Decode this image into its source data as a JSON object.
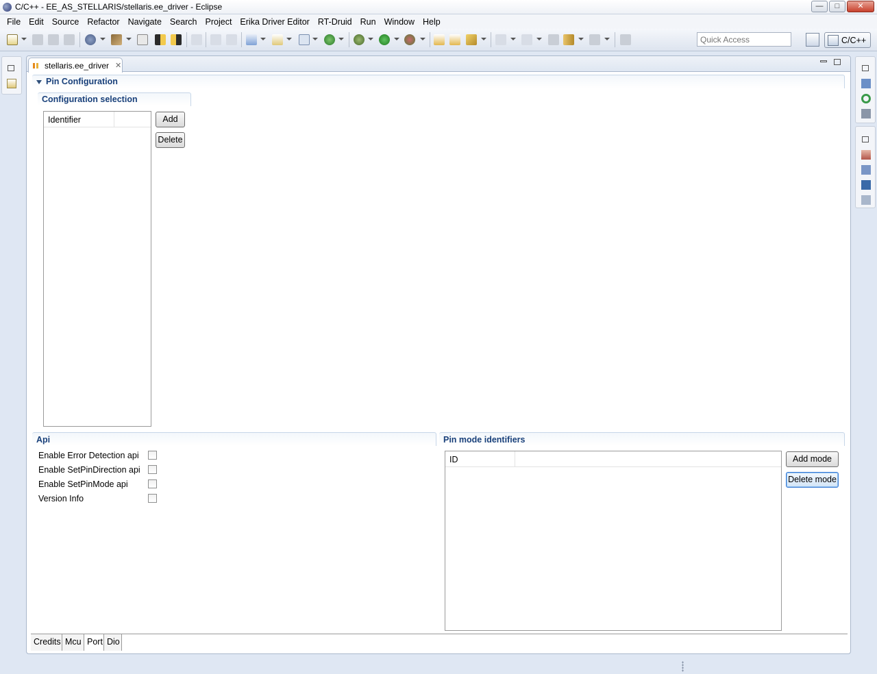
{
  "window": {
    "title": "C/C++ - EE_AS_STELLARIS/stellaris.ee_driver - Eclipse",
    "minimize": "—",
    "maximize": "□",
    "close": "✕"
  },
  "menubar": {
    "items": [
      "File",
      "Edit",
      "Source",
      "Refactor",
      "Navigate",
      "Search",
      "Project",
      "Erika Driver Editor",
      "RT-Druid",
      "Run",
      "Window",
      "Help"
    ]
  },
  "toolbar": {
    "quick_access_placeholder": "Quick Access",
    "perspective_label": "C/C++"
  },
  "editor": {
    "tab_label": "stellaris.ee_driver",
    "tab_close": "✕",
    "pin_configuration": {
      "title": "Pin Configuration",
      "config_selection": {
        "title": "Configuration selection",
        "table_header": "Identifier",
        "add_button": "Add",
        "delete_button": "Delete"
      }
    },
    "api": {
      "title": "Api",
      "options": [
        {
          "label": "Enable Error Detection api",
          "checked": false
        },
        {
          "label": "Enable SetPinDirection api",
          "checked": false
        },
        {
          "label": "Enable SetPinMode api",
          "checked": false
        },
        {
          "label": "Version Info",
          "checked": false
        }
      ]
    },
    "pin_mode_identifiers": {
      "title": "Pin mode identifiers",
      "table_header": "ID",
      "add_button": "Add mode",
      "delete_button": "Delete mode"
    },
    "bottom_tabs": [
      {
        "label": "Credits",
        "selected": false
      },
      {
        "label": "Mcu",
        "selected": false
      },
      {
        "label": "Port",
        "selected": true
      },
      {
        "label": "Dio",
        "selected": false
      }
    ]
  },
  "colors": {
    "section_title": "#19407a",
    "workbench_bg": "#dfe7f3",
    "focus_border": "#3a7bd5"
  }
}
